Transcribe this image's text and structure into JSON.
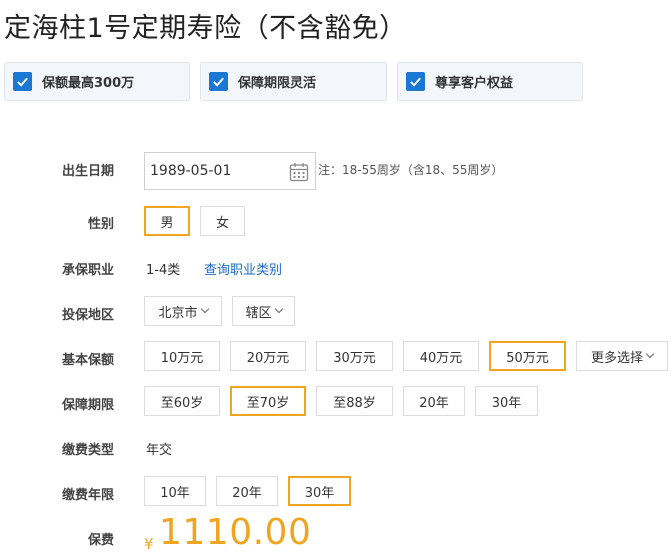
{
  "title": "定海柱1号定期寿险（不含豁免）",
  "features": [
    "保额最高300万",
    "保障期限灵活",
    "尊享客户权益"
  ],
  "birth": {
    "label": "出生日期",
    "value": "1989-05-01",
    "note": "注：18-55周岁（含18、55周岁）"
  },
  "gender": {
    "label": "性别",
    "options": [
      "男",
      "女"
    ],
    "selected": "男"
  },
  "occupation": {
    "label": "承保职业",
    "value": "1-4类",
    "link": "查询职业类别"
  },
  "region": {
    "label": "投保地区",
    "city": "北京市",
    "district": "辖区"
  },
  "coverage": {
    "label": "基本保额",
    "options": [
      "10万元",
      "20万元",
      "30万元",
      "40万元",
      "50万元"
    ],
    "selected": "50万元",
    "more": "更多选择"
  },
  "period": {
    "label": "保障期限",
    "options": [
      "至60岁",
      "至70岁",
      "至88岁",
      "20年",
      "30年"
    ],
    "selected": "至70岁"
  },
  "payment_type": {
    "label": "缴费类型",
    "value": "年交"
  },
  "payment_years": {
    "label": "缴费年限",
    "options": [
      "10年",
      "20年",
      "30年"
    ],
    "selected": "30年"
  },
  "premium": {
    "label": "保费",
    "currency": "¥",
    "amount": "1110.00"
  },
  "colors": {
    "accent": "#f0a520",
    "check": "#1a78d4",
    "link": "#1a6cc4"
  }
}
